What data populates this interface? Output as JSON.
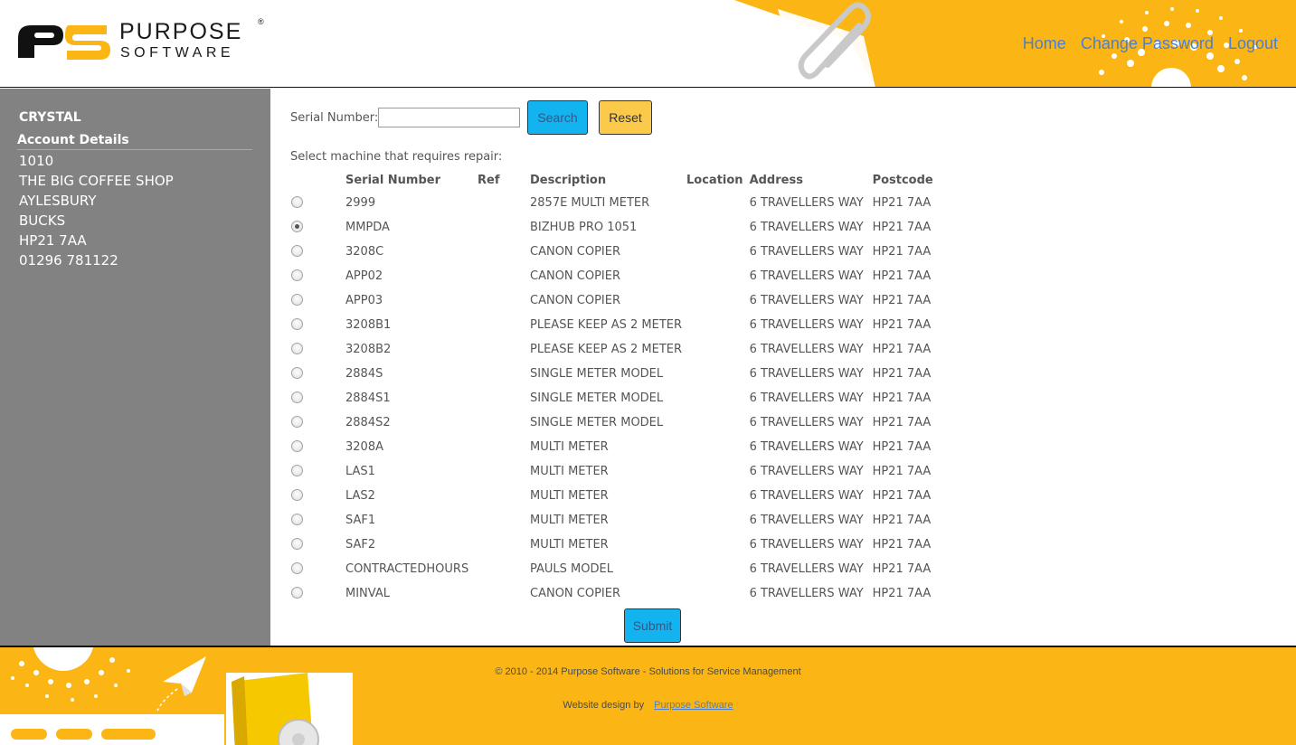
{
  "brand": {
    "name_top": "PURPOSE",
    "name_bottom": "SOFTWARE",
    "registered_mark": "®",
    "accent_color": "#fbb615"
  },
  "nav": {
    "home": "Home",
    "change_password": "Change Password",
    "logout": "Logout"
  },
  "sidebar": {
    "customer_name": "CRYSTAL",
    "section_title": "Account Details",
    "account_lines": [
      "1010",
      "THE BIG COFFEE SHOP",
      "AYLESBURY",
      "BUCKS",
      "HP21 7AA",
      "01296 781122"
    ]
  },
  "search": {
    "label": "Serial Number:",
    "value": "",
    "search_label": "Search",
    "reset_label": "Reset"
  },
  "machines": {
    "prompt": "Select machine that requires repair:",
    "headers": {
      "serial": "Serial Number",
      "ref": "Ref",
      "description": "Description",
      "location": "Location",
      "address": "Address",
      "postcode": "Postcode"
    },
    "selected_index": 1,
    "rows": [
      {
        "serial": "2999",
        "ref": "",
        "description": "2857E MULTI METER",
        "location": "",
        "address": "6 TRAVELLERS WAY",
        "postcode": "HP21 7AA"
      },
      {
        "serial": "MMPDA",
        "ref": "",
        "description": "BIZHUB PRO 1051",
        "location": "",
        "address": "6 TRAVELLERS WAY",
        "postcode": "HP21 7AA"
      },
      {
        "serial": "3208C",
        "ref": "",
        "description": "CANON COPIER",
        "location": "",
        "address": "6 TRAVELLERS WAY",
        "postcode": "HP21 7AA"
      },
      {
        "serial": "APP02",
        "ref": "",
        "description": "CANON COPIER",
        "location": "",
        "address": "6 TRAVELLERS WAY",
        "postcode": "HP21 7AA"
      },
      {
        "serial": "APP03",
        "ref": "",
        "description": "CANON COPIER",
        "location": "",
        "address": "6 TRAVELLERS WAY",
        "postcode": "HP21 7AA"
      },
      {
        "serial": "3208B1",
        "ref": "",
        "description": "PLEASE KEEP AS 2 METER",
        "location": "",
        "address": "6 TRAVELLERS WAY",
        "postcode": "HP21 7AA"
      },
      {
        "serial": "3208B2",
        "ref": "",
        "description": "PLEASE KEEP AS 2 METER",
        "location": "",
        "address": "6 TRAVELLERS WAY",
        "postcode": "HP21 7AA"
      },
      {
        "serial": "2884S",
        "ref": "",
        "description": "SINGLE METER MODEL",
        "location": "",
        "address": "6 TRAVELLERS WAY",
        "postcode": "HP21 7AA"
      },
      {
        "serial": "2884S1",
        "ref": "",
        "description": "SINGLE METER MODEL",
        "location": "",
        "address": "6 TRAVELLERS WAY",
        "postcode": "HP21 7AA"
      },
      {
        "serial": "2884S2",
        "ref": "",
        "description": "SINGLE METER MODEL",
        "location": "",
        "address": "6 TRAVELLERS WAY",
        "postcode": "HP21 7AA"
      },
      {
        "serial": "3208A",
        "ref": "",
        "description": "MULTI METER",
        "location": "",
        "address": "6 TRAVELLERS WAY",
        "postcode": "HP21 7AA"
      },
      {
        "serial": "LAS1",
        "ref": "",
        "description": "MULTI METER",
        "location": "",
        "address": "6 TRAVELLERS WAY",
        "postcode": "HP21 7AA"
      },
      {
        "serial": "LAS2",
        "ref": "",
        "description": "MULTI METER",
        "location": "",
        "address": "6 TRAVELLERS WAY",
        "postcode": "HP21 7AA"
      },
      {
        "serial": "SAF1",
        "ref": "",
        "description": "MULTI METER",
        "location": "",
        "address": "6 TRAVELLERS WAY",
        "postcode": "HP21 7AA"
      },
      {
        "serial": "SAF2",
        "ref": "",
        "description": "MULTI METER",
        "location": "",
        "address": "6 TRAVELLERS WAY",
        "postcode": "HP21 7AA"
      },
      {
        "serial": "CONTRACTEDHOURS",
        "ref": "",
        "description": "PAULS MODEL",
        "location": "",
        "address": "6 TRAVELLERS WAY",
        "postcode": "HP21 7AA"
      },
      {
        "serial": "MINVAL",
        "ref": "",
        "description": "CANON COPIER",
        "location": "",
        "address": "6 TRAVELLERS WAY",
        "postcode": "HP21 7AA"
      }
    ],
    "submit_label": "Submit"
  },
  "footer": {
    "copyright": "© 2010 - 2014 Purpose Software - Solutions for Service Management",
    "credit_prefix": "Website design by",
    "credit_link": "Purpose Software"
  }
}
